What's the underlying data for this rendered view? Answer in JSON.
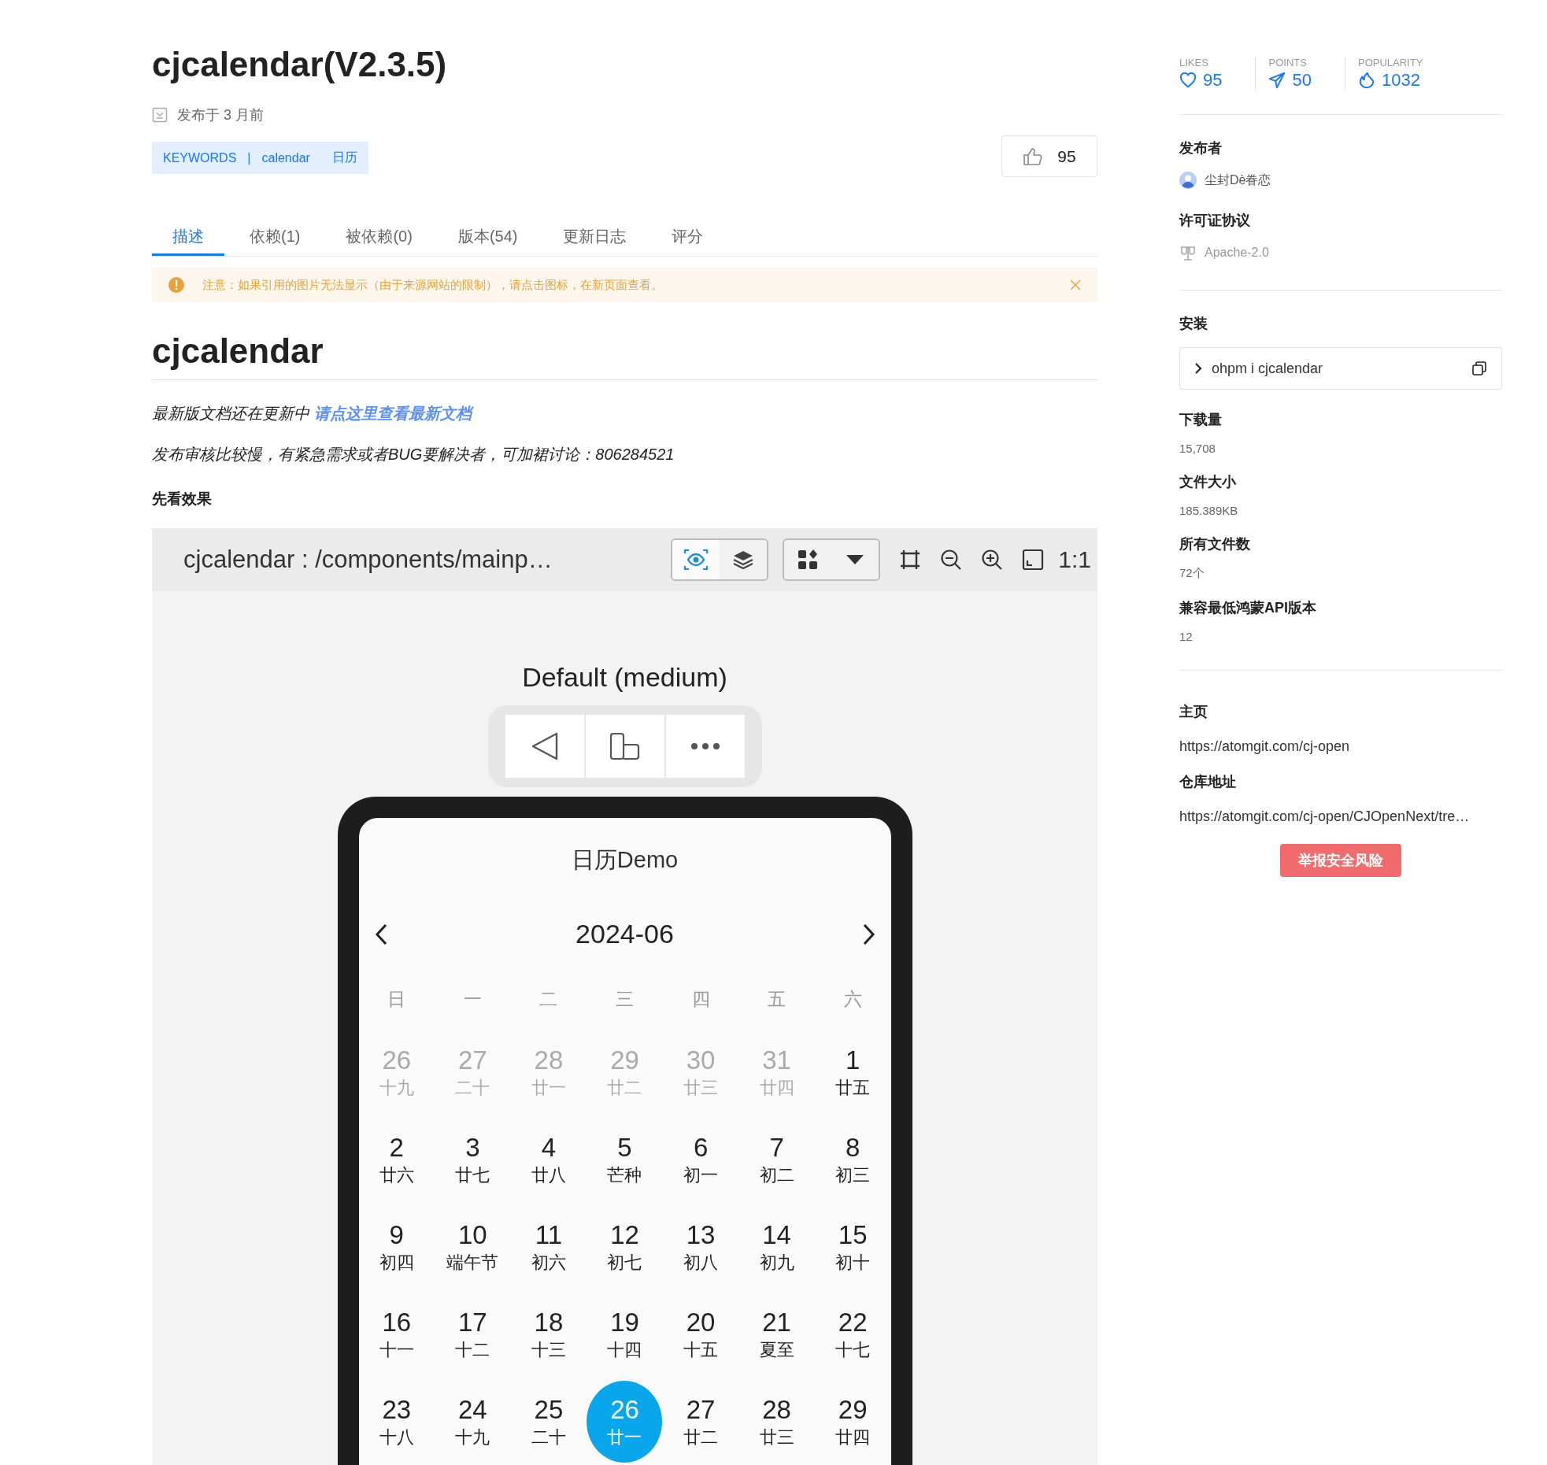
{
  "package": {
    "title": "cjcalendar(V2.3.5)",
    "published": "发布于  3 月前",
    "keywords": {
      "label": "KEYWORDS",
      "separator": "|",
      "tags": [
        "calendar",
        "日历"
      ]
    },
    "like_count": "95"
  },
  "tabs": [
    {
      "label": "描述",
      "selected": true
    },
    {
      "label": "依赖(1)",
      "selected": false
    },
    {
      "label": "被依赖(0)",
      "selected": false
    },
    {
      "label": "版本(54)",
      "selected": false
    },
    {
      "label": "更新日志",
      "selected": false
    },
    {
      "label": "评分",
      "selected": false
    }
  ],
  "notice": {
    "text": "注意：如果引用的图片无法显示（由于来源网站的限制），请点击图标，在新页面查看。"
  },
  "readme": {
    "heading": "cjcalendar",
    "line_1": {
      "text": "最新版文档还在更新中",
      "link": "请点这里查看最新文档"
    },
    "line_2": "发布审核比较慢，有紧急需求或者BUG要解决者，可加裙讨论：806284521",
    "subheading": "先看效果",
    "preview": {
      "toolbar_title": "cjcalendar : /components/mainp…",
      "toolbar_ratio": "1:1",
      "device_label": "Default (medium)",
      "app": {
        "title": "日历Demo",
        "month": "2024-06",
        "weekdays": [
          "日",
          "一",
          "二",
          "三",
          "四",
          "五",
          "六"
        ],
        "weeks": [
          [
            {
              "day": "26",
              "lunar": "十九",
              "kind": "other",
              "selected": false
            },
            {
              "day": "27",
              "lunar": "二十",
              "kind": "other",
              "selected": false
            },
            {
              "day": "28",
              "lunar": "廿一",
              "kind": "other",
              "selected": false
            },
            {
              "day": "29",
              "lunar": "廿二",
              "kind": "other",
              "selected": false
            },
            {
              "day": "30",
              "lunar": "廿三",
              "kind": "other",
              "selected": false
            },
            {
              "day": "31",
              "lunar": "廿四",
              "kind": "other",
              "selected": false
            },
            {
              "day": "1",
              "lunar": "廿五",
              "kind": "current",
              "selected": false
            }
          ],
          [
            {
              "day": "2",
              "lunar": "廿六",
              "kind": "current",
              "selected": false
            },
            {
              "day": "3",
              "lunar": "廿七",
              "kind": "current",
              "selected": false
            },
            {
              "day": "4",
              "lunar": "廿八",
              "kind": "current",
              "selected": false
            },
            {
              "day": "5",
              "lunar": "芒种",
              "kind": "current",
              "selected": false
            },
            {
              "day": "6",
              "lunar": "初一",
              "kind": "current",
              "selected": false
            },
            {
              "day": "7",
              "lunar": "初二",
              "kind": "current",
              "selected": false
            },
            {
              "day": "8",
              "lunar": "初三",
              "kind": "current",
              "selected": false
            }
          ],
          [
            {
              "day": "9",
              "lunar": "初四",
              "kind": "current",
              "selected": false
            },
            {
              "day": "10",
              "lunar": "端午节",
              "kind": "current",
              "selected": false
            },
            {
              "day": "11",
              "lunar": "初六",
              "kind": "current",
              "selected": false
            },
            {
              "day": "12",
              "lunar": "初七",
              "kind": "current",
              "selected": false
            },
            {
              "day": "13",
              "lunar": "初八",
              "kind": "current",
              "selected": false
            },
            {
              "day": "14",
              "lunar": "初九",
              "kind": "current",
              "selected": false
            },
            {
              "day": "15",
              "lunar": "初十",
              "kind": "current",
              "selected": false
            }
          ],
          [
            {
              "day": "16",
              "lunar": "十一",
              "kind": "current",
              "selected": false
            },
            {
              "day": "17",
              "lunar": "十二",
              "kind": "current",
              "selected": false
            },
            {
              "day": "18",
              "lunar": "十三",
              "kind": "current",
              "selected": false
            },
            {
              "day": "19",
              "lunar": "十四",
              "kind": "current",
              "selected": false
            },
            {
              "day": "20",
              "lunar": "十五",
              "kind": "current",
              "selected": false
            },
            {
              "day": "21",
              "lunar": "夏至",
              "kind": "current",
              "selected": false
            },
            {
              "day": "22",
              "lunar": "十七",
              "kind": "current",
              "selected": false
            }
          ],
          [
            {
              "day": "23",
              "lunar": "十八",
              "kind": "current",
              "selected": false
            },
            {
              "day": "24",
              "lunar": "十九",
              "kind": "current",
              "selected": false
            },
            {
              "day": "25",
              "lunar": "二十",
              "kind": "current",
              "selected": false
            },
            {
              "day": "26",
              "lunar": "廿一",
              "kind": "current",
              "selected": true
            },
            {
              "day": "27",
              "lunar": "廿二",
              "kind": "current",
              "selected": false
            },
            {
              "day": "28",
              "lunar": "廿三",
              "kind": "current",
              "selected": false
            },
            {
              "day": "29",
              "lunar": "廿四",
              "kind": "current",
              "selected": false
            }
          ]
        ]
      }
    }
  },
  "sidebar": {
    "stats": [
      {
        "kind": "likes",
        "label": "LIKES",
        "value": "95"
      },
      {
        "kind": "points",
        "label": "POINTS",
        "value": "50"
      },
      {
        "kind": "popularity",
        "label": "POPULARITY",
        "value": "1032"
      }
    ],
    "publisher": {
      "heading": "发布者",
      "name": "尘封Dè眷恋"
    },
    "license": {
      "heading": "许可证协议",
      "name": "Apache-2.0"
    },
    "install": {
      "heading": "安装",
      "command": "ohpm i cjcalendar"
    },
    "facts": [
      {
        "label": "下载量",
        "value": "15,708"
      },
      {
        "label": "文件大小",
        "value": "185.389KB"
      },
      {
        "label": "所有文件数",
        "value": "72个"
      },
      {
        "label": "兼容最低鸿蒙API版本",
        "value": "12"
      }
    ],
    "links": [
      {
        "label": "主页",
        "url": "https://atomgit.com/cj-open"
      },
      {
        "label": "仓库地址",
        "url": "https://atomgit.com/cj-open/CJOpenNext/tre…"
      }
    ],
    "report_button": "举报安全风险"
  }
}
